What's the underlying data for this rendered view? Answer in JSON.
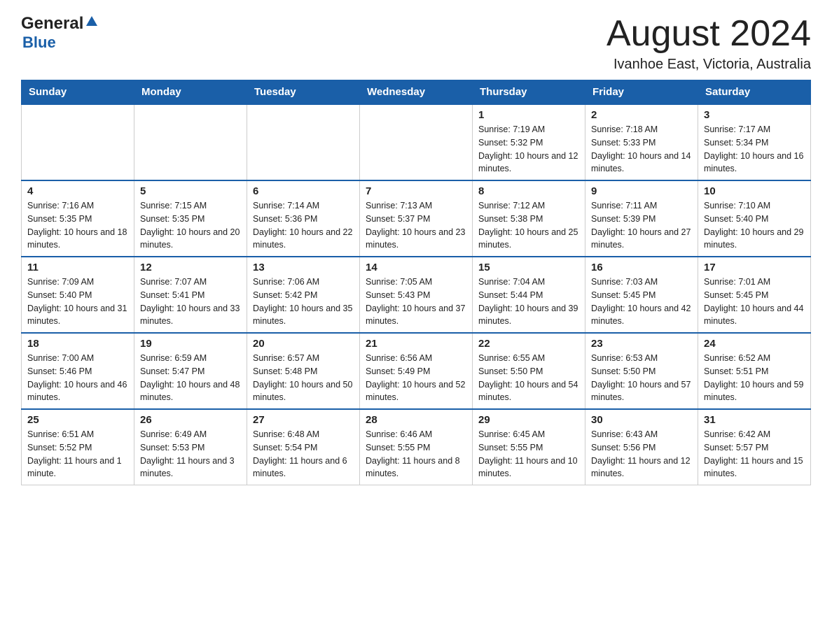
{
  "header": {
    "logo_general": "General",
    "logo_blue": "Blue",
    "main_title": "August 2024",
    "subtitle": "Ivanhoe East, Victoria, Australia"
  },
  "calendar": {
    "days_of_week": [
      "Sunday",
      "Monday",
      "Tuesday",
      "Wednesday",
      "Thursday",
      "Friday",
      "Saturday"
    ],
    "weeks": [
      {
        "days": [
          {
            "number": "",
            "info": ""
          },
          {
            "number": "",
            "info": ""
          },
          {
            "number": "",
            "info": ""
          },
          {
            "number": "",
            "info": ""
          },
          {
            "number": "1",
            "info": "Sunrise: 7:19 AM\nSunset: 5:32 PM\nDaylight: 10 hours and 12 minutes."
          },
          {
            "number": "2",
            "info": "Sunrise: 7:18 AM\nSunset: 5:33 PM\nDaylight: 10 hours and 14 minutes."
          },
          {
            "number": "3",
            "info": "Sunrise: 7:17 AM\nSunset: 5:34 PM\nDaylight: 10 hours and 16 minutes."
          }
        ]
      },
      {
        "days": [
          {
            "number": "4",
            "info": "Sunrise: 7:16 AM\nSunset: 5:35 PM\nDaylight: 10 hours and 18 minutes."
          },
          {
            "number": "5",
            "info": "Sunrise: 7:15 AM\nSunset: 5:35 PM\nDaylight: 10 hours and 20 minutes."
          },
          {
            "number": "6",
            "info": "Sunrise: 7:14 AM\nSunset: 5:36 PM\nDaylight: 10 hours and 22 minutes."
          },
          {
            "number": "7",
            "info": "Sunrise: 7:13 AM\nSunset: 5:37 PM\nDaylight: 10 hours and 23 minutes."
          },
          {
            "number": "8",
            "info": "Sunrise: 7:12 AM\nSunset: 5:38 PM\nDaylight: 10 hours and 25 minutes."
          },
          {
            "number": "9",
            "info": "Sunrise: 7:11 AM\nSunset: 5:39 PM\nDaylight: 10 hours and 27 minutes."
          },
          {
            "number": "10",
            "info": "Sunrise: 7:10 AM\nSunset: 5:40 PM\nDaylight: 10 hours and 29 minutes."
          }
        ]
      },
      {
        "days": [
          {
            "number": "11",
            "info": "Sunrise: 7:09 AM\nSunset: 5:40 PM\nDaylight: 10 hours and 31 minutes."
          },
          {
            "number": "12",
            "info": "Sunrise: 7:07 AM\nSunset: 5:41 PM\nDaylight: 10 hours and 33 minutes."
          },
          {
            "number": "13",
            "info": "Sunrise: 7:06 AM\nSunset: 5:42 PM\nDaylight: 10 hours and 35 minutes."
          },
          {
            "number": "14",
            "info": "Sunrise: 7:05 AM\nSunset: 5:43 PM\nDaylight: 10 hours and 37 minutes."
          },
          {
            "number": "15",
            "info": "Sunrise: 7:04 AM\nSunset: 5:44 PM\nDaylight: 10 hours and 39 minutes."
          },
          {
            "number": "16",
            "info": "Sunrise: 7:03 AM\nSunset: 5:45 PM\nDaylight: 10 hours and 42 minutes."
          },
          {
            "number": "17",
            "info": "Sunrise: 7:01 AM\nSunset: 5:45 PM\nDaylight: 10 hours and 44 minutes."
          }
        ]
      },
      {
        "days": [
          {
            "number": "18",
            "info": "Sunrise: 7:00 AM\nSunset: 5:46 PM\nDaylight: 10 hours and 46 minutes."
          },
          {
            "number": "19",
            "info": "Sunrise: 6:59 AM\nSunset: 5:47 PM\nDaylight: 10 hours and 48 minutes."
          },
          {
            "number": "20",
            "info": "Sunrise: 6:57 AM\nSunset: 5:48 PM\nDaylight: 10 hours and 50 minutes."
          },
          {
            "number": "21",
            "info": "Sunrise: 6:56 AM\nSunset: 5:49 PM\nDaylight: 10 hours and 52 minutes."
          },
          {
            "number": "22",
            "info": "Sunrise: 6:55 AM\nSunset: 5:50 PM\nDaylight: 10 hours and 54 minutes."
          },
          {
            "number": "23",
            "info": "Sunrise: 6:53 AM\nSunset: 5:50 PM\nDaylight: 10 hours and 57 minutes."
          },
          {
            "number": "24",
            "info": "Sunrise: 6:52 AM\nSunset: 5:51 PM\nDaylight: 10 hours and 59 minutes."
          }
        ]
      },
      {
        "days": [
          {
            "number": "25",
            "info": "Sunrise: 6:51 AM\nSunset: 5:52 PM\nDaylight: 11 hours and 1 minute."
          },
          {
            "number": "26",
            "info": "Sunrise: 6:49 AM\nSunset: 5:53 PM\nDaylight: 11 hours and 3 minutes."
          },
          {
            "number": "27",
            "info": "Sunrise: 6:48 AM\nSunset: 5:54 PM\nDaylight: 11 hours and 6 minutes."
          },
          {
            "number": "28",
            "info": "Sunrise: 6:46 AM\nSunset: 5:55 PM\nDaylight: 11 hours and 8 minutes."
          },
          {
            "number": "29",
            "info": "Sunrise: 6:45 AM\nSunset: 5:55 PM\nDaylight: 11 hours and 10 minutes."
          },
          {
            "number": "30",
            "info": "Sunrise: 6:43 AM\nSunset: 5:56 PM\nDaylight: 11 hours and 12 minutes."
          },
          {
            "number": "31",
            "info": "Sunrise: 6:42 AM\nSunset: 5:57 PM\nDaylight: 11 hours and 15 minutes."
          }
        ]
      }
    ]
  }
}
